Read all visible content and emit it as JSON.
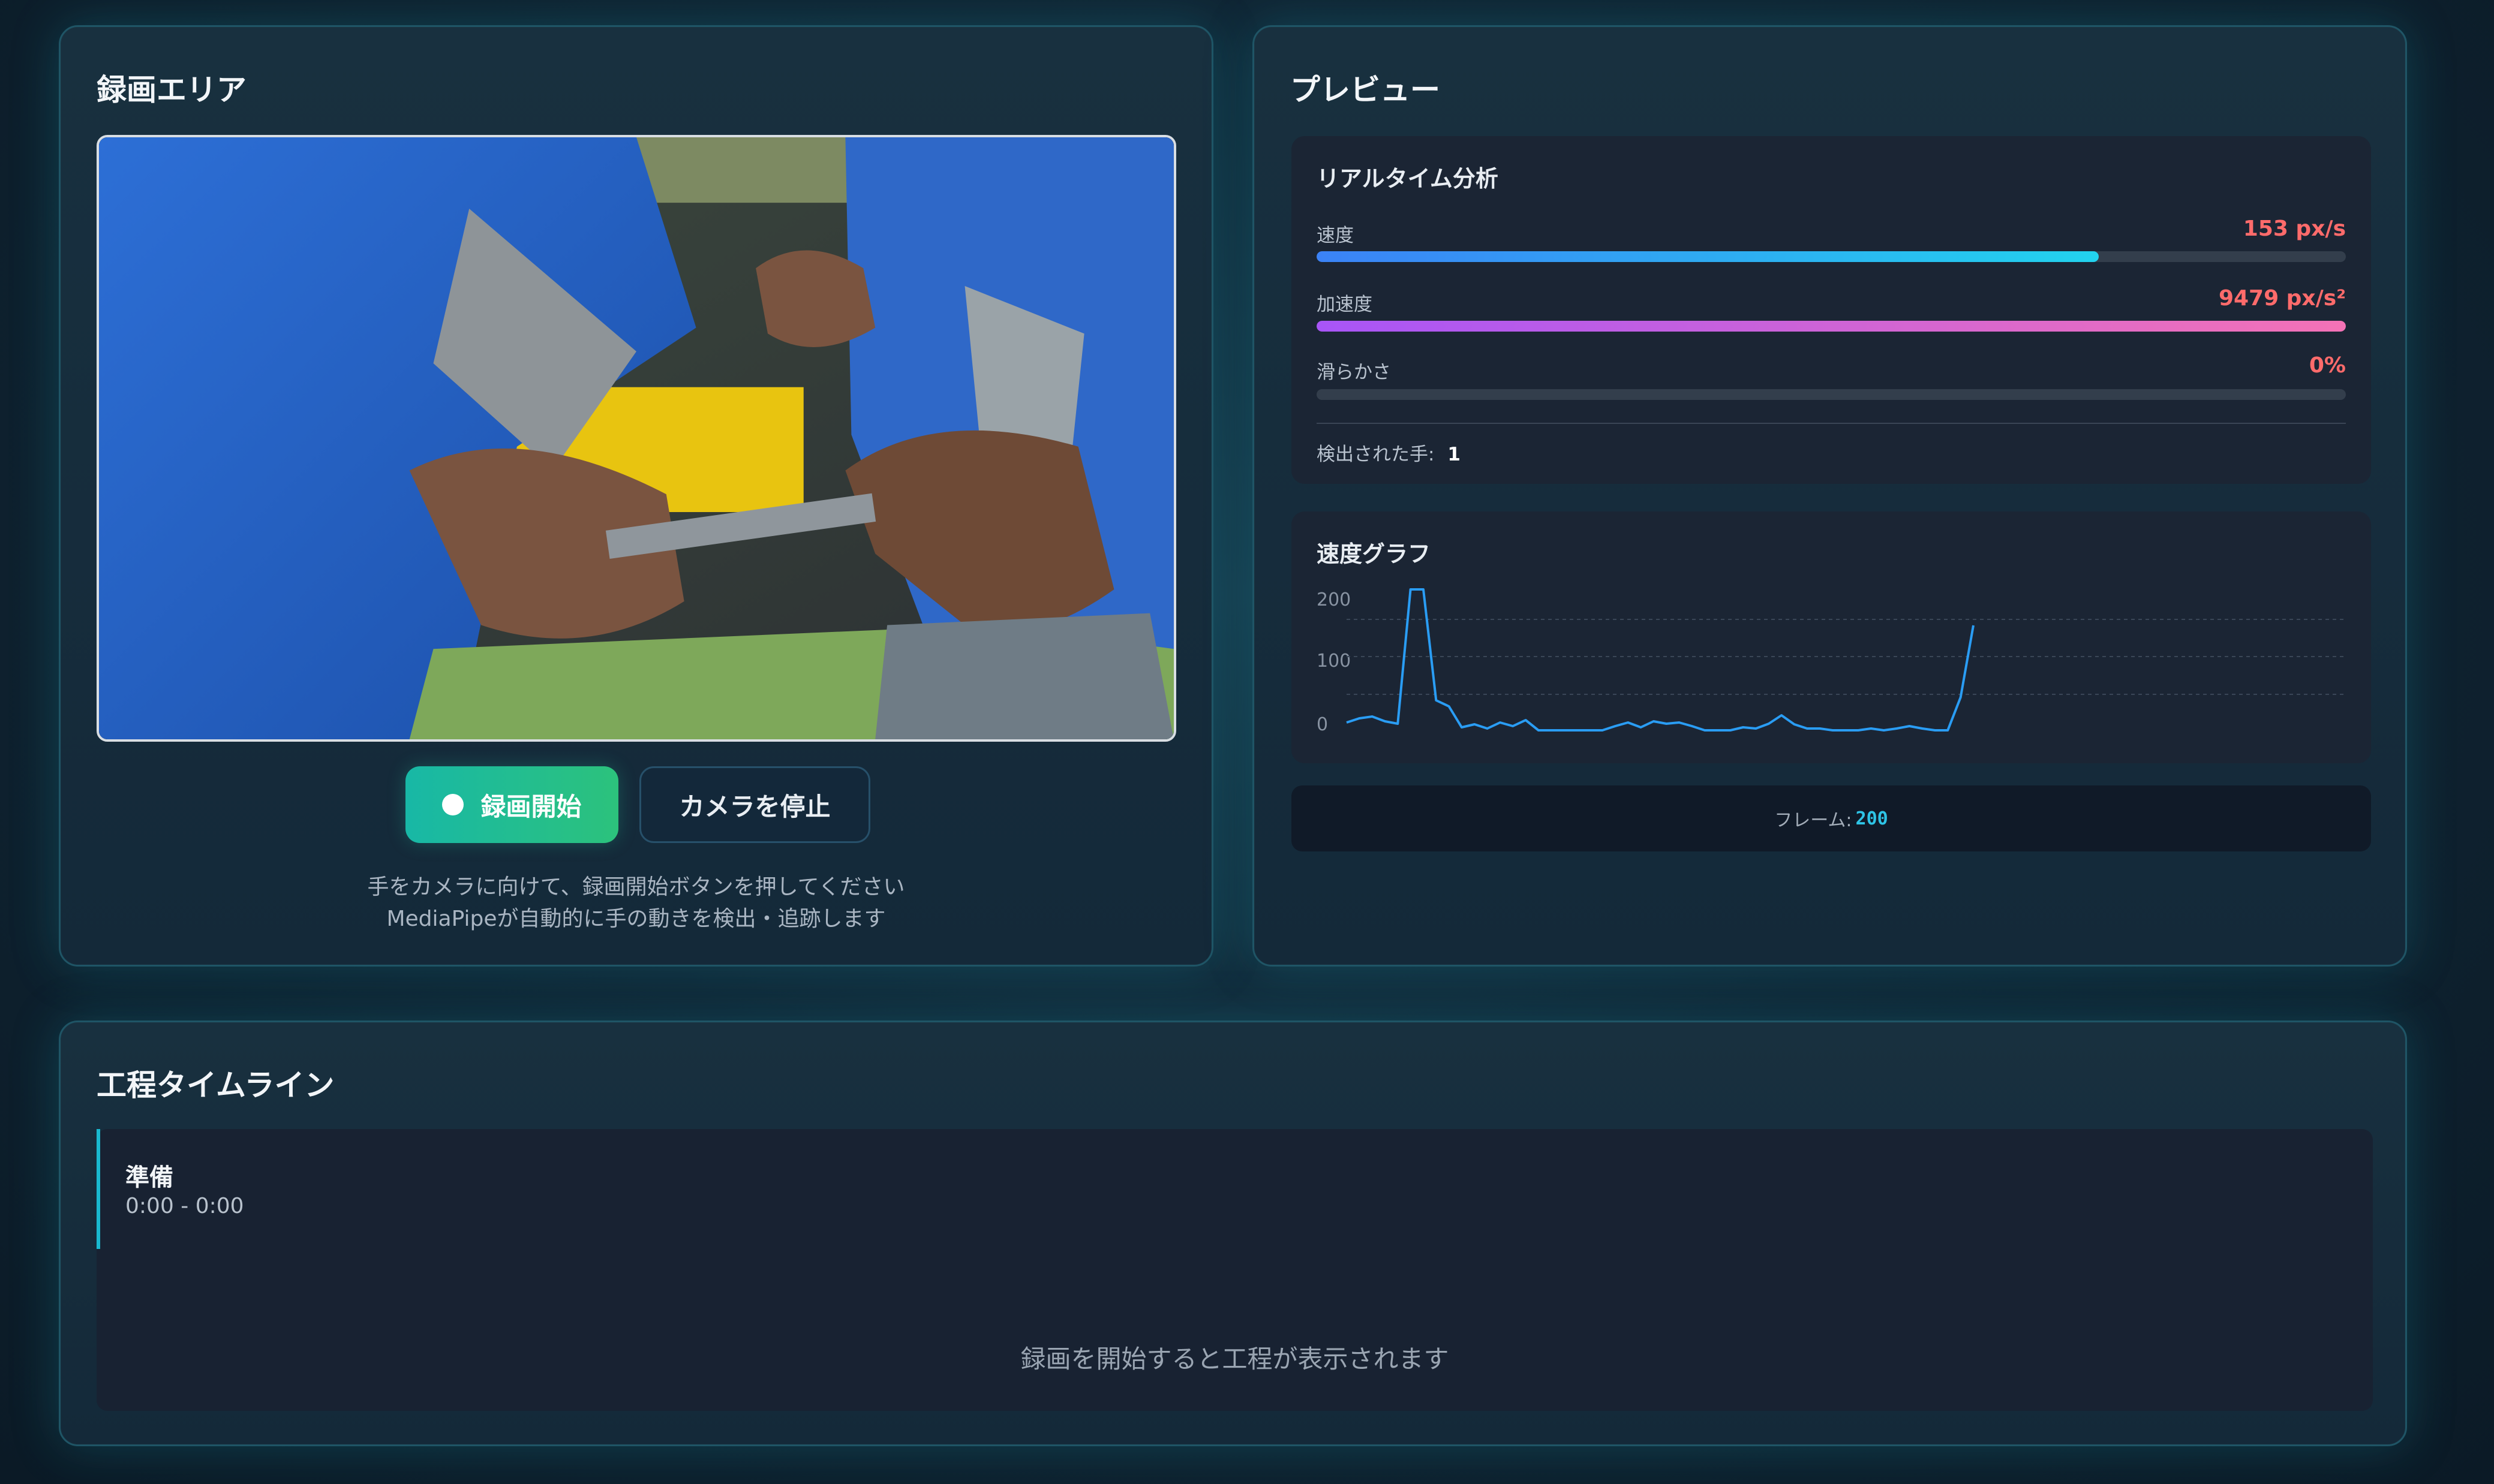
{
  "recording": {
    "title": "録画エリア",
    "start_button": "録画開始",
    "stop_camera_button": "カメラを停止",
    "hint_line1": "手をカメラに向けて、録画開始ボタンを押してください",
    "hint_line2": "MediaPipeが自動的に手の動きを検出・追跡します"
  },
  "preview": {
    "title": "プレビュー",
    "analysis": {
      "title": "リアルタイム分析",
      "metrics": [
        {
          "label": "速度",
          "value": "153 px/s",
          "fill": 0.76,
          "gradient": [
            "#3b82f6",
            "#22d3ee"
          ]
        },
        {
          "label": "加速度",
          "value": "9479 px/s²",
          "fill": 1.0,
          "gradient": [
            "#a855f7",
            "#f472b6"
          ]
        },
        {
          "label": "滑らかさ",
          "value": "0%",
          "fill": 0.0,
          "gradient": [
            "#a855f7",
            "#f472b6"
          ]
        }
      ],
      "hands_label": "検出された手:",
      "hands_value": "1"
    },
    "graph": {
      "title": "速度グラフ"
    },
    "frame_label": "フレーム:",
    "frame_value": "200"
  },
  "chart_data": {
    "type": "line",
    "title": "速度グラフ",
    "xlabel": "",
    "ylabel": "",
    "ylim": [
      0,
      240
    ],
    "yticks": [
      "200",
      "100",
      "0"
    ],
    "grid": true,
    "series": [
      {
        "color": "#2a9df4",
        "values": [
          18,
          25,
          28,
          20,
          16,
          240,
          240,
          55,
          45,
          10,
          15,
          8,
          18,
          12,
          22,
          5,
          5,
          5,
          5,
          5,
          5,
          12,
          18,
          10,
          20,
          16,
          18,
          12,
          5,
          5,
          5,
          10,
          8,
          16,
          30,
          15,
          8,
          8,
          5,
          5,
          5,
          8,
          5,
          8,
          12,
          8,
          5,
          5,
          60,
          180
        ]
      }
    ]
  },
  "timeline": {
    "title": "工程タイムライン",
    "phases": [
      {
        "name": "準備",
        "time": "0:00 - 0:00"
      }
    ],
    "empty_message": "録画を開始すると工程が表示されます"
  }
}
